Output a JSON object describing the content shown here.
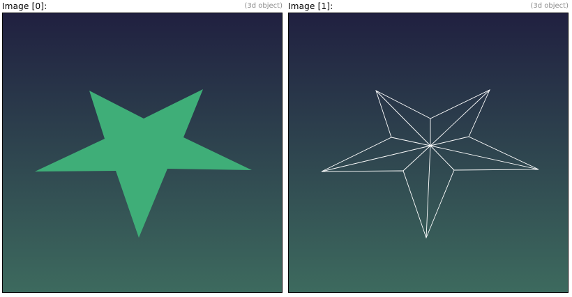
{
  "panels": [
    {
      "title": "Image [0]:",
      "tag": "(3d object)",
      "render_mode": "solid",
      "fill_color": "#3fae78"
    },
    {
      "title": "Image [1]:",
      "tag": "(3d object)",
      "render_mode": "wireframe",
      "line_color": "#ffffff"
    }
  ],
  "colors": {
    "viewport_top": "#202040",
    "viewport_bottom": "#3d6a5e",
    "border": "#000000"
  }
}
